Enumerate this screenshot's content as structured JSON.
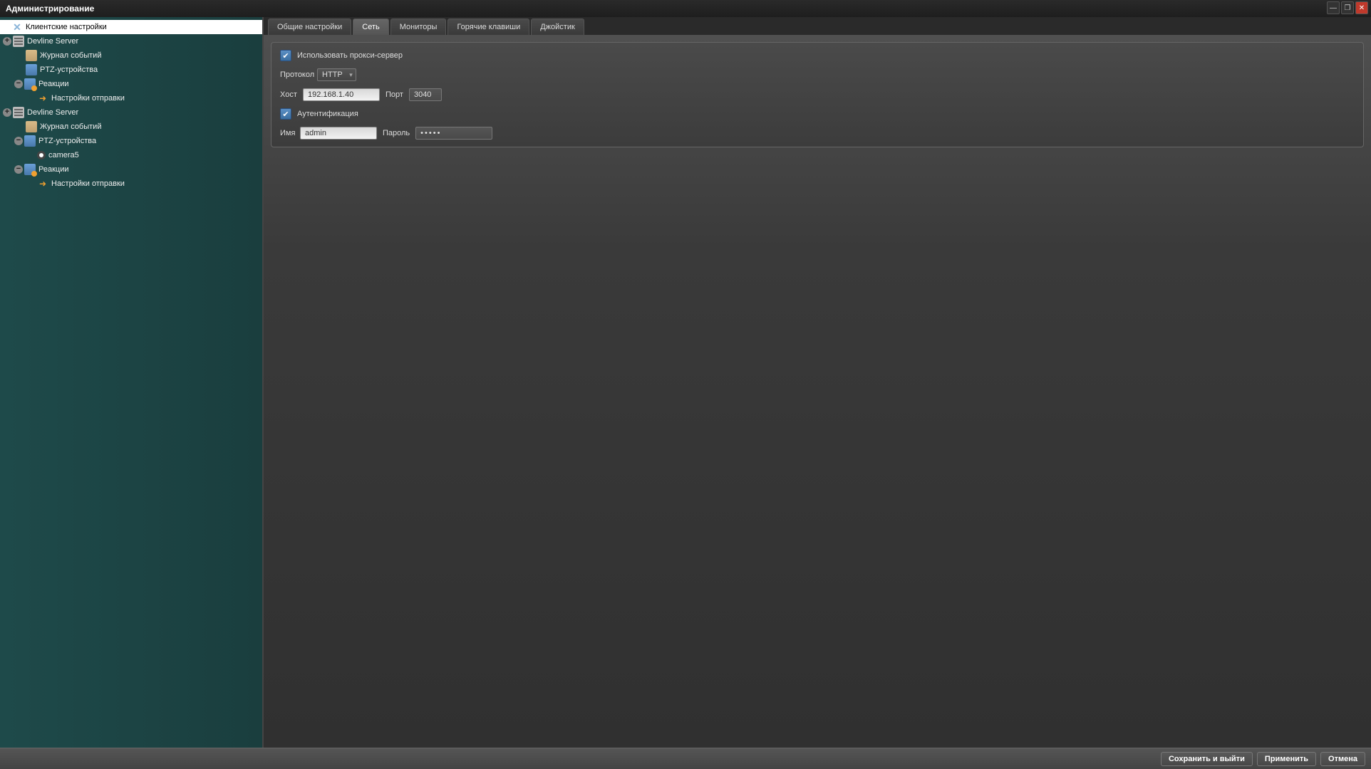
{
  "window": {
    "title": "Администрирование"
  },
  "tree": {
    "client_settings": "Клиентские настройки",
    "server1": "Devline Server",
    "journal1": "Журнал событий",
    "ptz1": "PTZ-устройства",
    "reactions1": "Реакции",
    "sendset1": "Настройки отправки",
    "server2": "Devline Server",
    "journal2": "Журнал событий",
    "ptz2": "PTZ-устройства",
    "camera5": "camera5",
    "reactions2": "Реакции",
    "sendset2": "Настройки отправки"
  },
  "tabs": {
    "general": "Общие настройки",
    "network": "Сеть",
    "monitors": "Мониторы",
    "hotkeys": "Горячие клавиши",
    "joystick": "Джойстик"
  },
  "form": {
    "use_proxy": "Использовать прокси-сервер",
    "protocol_label": "Протокол",
    "protocol_value": "HTTP",
    "host_label": "Хост",
    "host_value": "192.168.1.40",
    "port_label": "Порт",
    "port_value": "3040",
    "auth_label": "Аутентификация",
    "name_label": "Имя",
    "name_value": "admin",
    "password_label": "Пароль",
    "password_value": "•••••"
  },
  "buttons": {
    "save_exit": "Сохранить и выйти",
    "apply": "Применить",
    "cancel": "Отмена"
  }
}
